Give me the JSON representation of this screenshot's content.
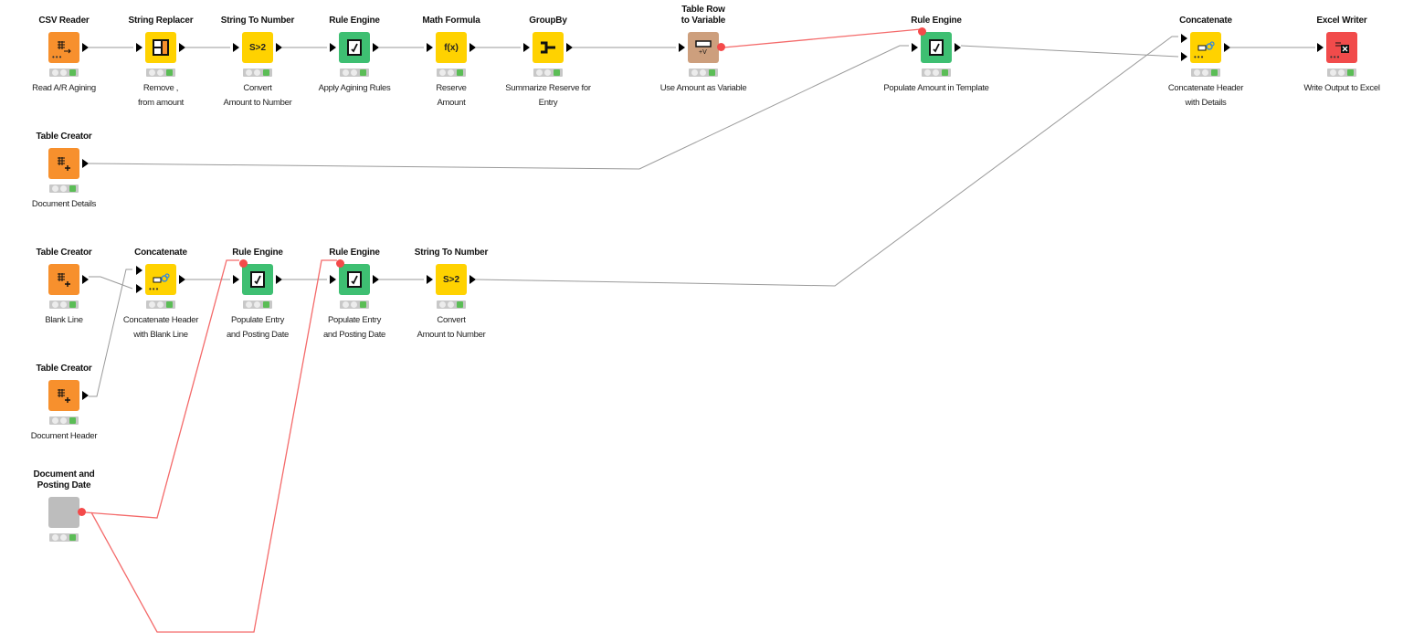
{
  "workflow": {
    "colors": {
      "source": "#f7902d",
      "manipulator": "#ffd200",
      "rule": "#3ebf72",
      "flowvar": "#cd9f7d",
      "sink": "#f14b4b",
      "component": "#bdbdbd",
      "wire": "#9a9a9a",
      "var_wire": "#f46a6a",
      "var_port": "#f44a4a",
      "led_green": "#5bbd56"
    },
    "nodes": [
      {
        "id": "n1",
        "title": "CSV Reader",
        "label": "Read A/R Agining",
        "type": "source",
        "icon": "csv-reader-icon",
        "status": "executed"
      },
      {
        "id": "n2",
        "title": "String Replacer",
        "label": "Remove ,\nfrom amount",
        "type": "manipulator",
        "icon": "string-replacer-icon",
        "status": "executed"
      },
      {
        "id": "n3",
        "title": "String To Number",
        "label": "Convert\nAmount to Number",
        "type": "manipulator",
        "icon": "string-to-number-icon",
        "icon_text": "S>2",
        "status": "executed"
      },
      {
        "id": "n4",
        "title": "Rule Engine",
        "label": "Apply Agining Rules",
        "type": "rule",
        "icon": "rule-engine-icon",
        "status": "executed"
      },
      {
        "id": "n5",
        "title": "Math Formula",
        "label": "Reserve\nAmount",
        "type": "manipulator",
        "icon": "math-formula-icon",
        "icon_text": "f(x)",
        "status": "executed"
      },
      {
        "id": "n6",
        "title": "GroupBy",
        "label": "Summarize Reserve for\nEntry",
        "type": "manipulator",
        "icon": "groupby-icon",
        "status": "executed"
      },
      {
        "id": "n7",
        "title": "Table Row\nto Variable",
        "label": "Use Amount as Variable",
        "type": "flowvar",
        "icon": "table-row-to-variable-icon",
        "status": "executed"
      },
      {
        "id": "n8",
        "title": "Rule Engine",
        "label": "Populate Amount in Template",
        "type": "rule",
        "icon": "rule-engine-icon",
        "status": "executed"
      },
      {
        "id": "n9",
        "title": "Concatenate",
        "label": "Concatenate Header\nwith  Details",
        "type": "manipulator",
        "icon": "concatenate-icon",
        "status": "executed"
      },
      {
        "id": "n10",
        "title": "Excel Writer",
        "label": "Write Output to Excel",
        "type": "sink",
        "icon": "excel-writer-icon",
        "status": "executed"
      },
      {
        "id": "n11",
        "title": "Table Creator",
        "label": "Document Details",
        "type": "source",
        "icon": "table-creator-icon",
        "status": "executed"
      },
      {
        "id": "n12",
        "title": "Table Creator",
        "label": "Blank Line",
        "type": "source",
        "icon": "table-creator-icon",
        "status": "executed"
      },
      {
        "id": "n13",
        "title": "Concatenate",
        "label": "Concatenate Header\nwith Blank Line",
        "type": "manipulator",
        "icon": "concatenate-icon",
        "status": "executed"
      },
      {
        "id": "n14",
        "title": "Rule Engine",
        "label": "Populate     Entry\nand Posting Date",
        "type": "rule",
        "icon": "rule-engine-icon",
        "status": "executed"
      },
      {
        "id": "n15",
        "title": "Rule Engine",
        "label": "Populate     Entry\nand Posting Date",
        "type": "rule",
        "icon": "rule-engine-icon",
        "status": "executed"
      },
      {
        "id": "n16",
        "title": "String To Number",
        "label": "Convert\nAmount to Number",
        "type": "manipulator",
        "icon": "string-to-number-icon",
        "icon_text": "S>2",
        "status": "executed"
      },
      {
        "id": "n17",
        "title": "Table Creator",
        "label": "Document Header",
        "type": "source",
        "icon": "table-creator-icon",
        "status": "executed"
      },
      {
        "id": "n18",
        "title": "Document and\nPosting Date",
        "label": "",
        "type": "component",
        "icon": "component-icon",
        "status": "executed"
      }
    ],
    "connections": [
      {
        "from": "n1",
        "to": "n2",
        "kind": "data"
      },
      {
        "from": "n2",
        "to": "n3",
        "kind": "data"
      },
      {
        "from": "n3",
        "to": "n4",
        "kind": "data"
      },
      {
        "from": "n4",
        "to": "n5",
        "kind": "data"
      },
      {
        "from": "n5",
        "to": "n6",
        "kind": "data"
      },
      {
        "from": "n6",
        "to": "n7",
        "kind": "data"
      },
      {
        "from": "n7",
        "to": "n8",
        "kind": "variable"
      },
      {
        "from": "n11",
        "to": "n8",
        "kind": "data"
      },
      {
        "from": "n8",
        "to": "n9",
        "kind": "data",
        "port": 2
      },
      {
        "from": "n16",
        "to": "n9",
        "kind": "data",
        "port": 1
      },
      {
        "from": "n9",
        "to": "n10",
        "kind": "data"
      },
      {
        "from": "n12",
        "to": "n13",
        "kind": "data",
        "port": 2
      },
      {
        "from": "n17",
        "to": "n13",
        "kind": "data",
        "port": 1
      },
      {
        "from": "n13",
        "to": "n14",
        "kind": "data"
      },
      {
        "from": "n14",
        "to": "n15",
        "kind": "data"
      },
      {
        "from": "n15",
        "to": "n16",
        "kind": "data"
      },
      {
        "from": "n18",
        "to": "n14",
        "kind": "variable"
      },
      {
        "from": "n18",
        "to": "n15",
        "kind": "variable"
      }
    ]
  }
}
